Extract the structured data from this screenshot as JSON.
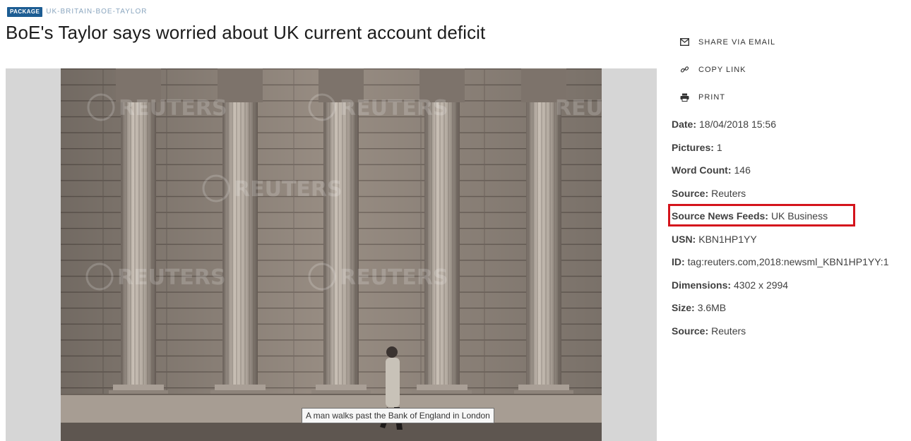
{
  "kicker": {
    "badge": "PACKAGE",
    "slug": "UK-BRITAIN-BOE-TAYLOR"
  },
  "headline": "BoE's Taylor says worried about UK current account deficit",
  "image": {
    "tooltip": "A man walks past the Bank of England in London",
    "watermark": "REUTERS"
  },
  "actions": [
    {
      "label": "SHARE VIA EMAIL",
      "icon": "envelope-icon"
    },
    {
      "label": "COPY LINK",
      "icon": "link-icon"
    },
    {
      "label": "PRINT",
      "icon": "printer-icon"
    }
  ],
  "metadata": [
    {
      "key": "Date:",
      "value": "18/04/2018 15:56"
    },
    {
      "key": "Pictures:",
      "value": "1"
    },
    {
      "key": "Word Count:",
      "value": "146"
    },
    {
      "key": "Source:",
      "value": "Reuters"
    },
    {
      "key": "Source News Feeds:",
      "value": "UK Business"
    },
    {
      "key": "USN:",
      "value": "KBN1HP1YY"
    },
    {
      "key": "ID:",
      "value": "tag:reuters.com,2018:newsml_KBN1HP1YY:1"
    },
    {
      "key": "Dimensions:",
      "value": "4302 x 2994"
    },
    {
      "key": "Size:",
      "value": "3.6MB"
    },
    {
      "key": "Source:",
      "value": "Reuters"
    }
  ],
  "colors": {
    "badge": "#1d5d93",
    "highlight": "#d4141c",
    "frame": "#d6d6d6"
  }
}
